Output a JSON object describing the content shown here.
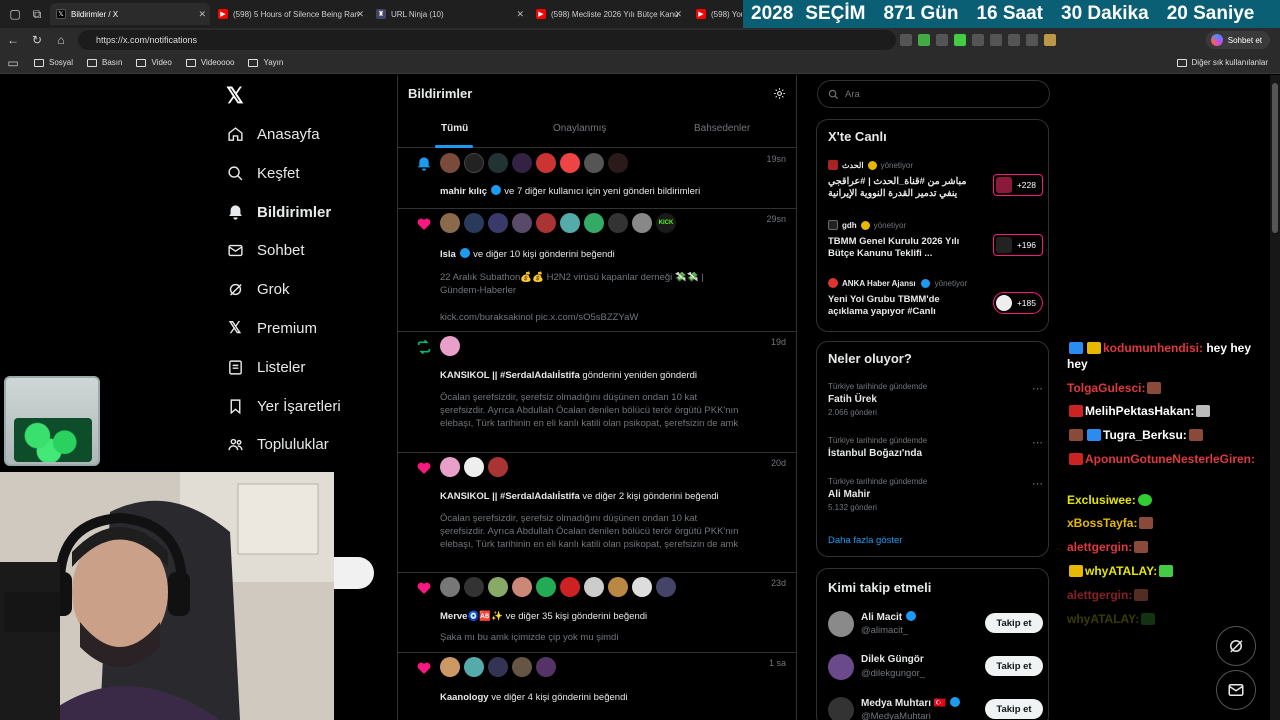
{
  "browser": {
    "tabs": [
      {
        "title": "Bildirimler / X",
        "favicon": "x-logo-icon"
      },
      {
        "title": "(598) 5 Hours of Silence Being Ran",
        "favicon": "youtube-icon"
      },
      {
        "title": "URL Ninja (10)",
        "favicon": "ninja-icon"
      },
      {
        "title": "(598) Mecliste 2026 Yılı Bütçe Kanu",
        "favicon": "youtube-icon"
      },
      {
        "title": "(598) You",
        "favicon": "youtube-icon"
      }
    ],
    "url": "https://x.com/notifications",
    "sohbet_label": "Sohbet et",
    "bookmarks": [
      "Sosyal",
      "Basın",
      "Video",
      "Videoooo",
      "Yayın"
    ],
    "bookmarks_other": "Diğer sık kullanılanlar"
  },
  "countdown": {
    "year": "2028",
    "label": "SEÇİM",
    "days": "871 Gün",
    "hours": "16 Saat",
    "minutes": "30 Dakika",
    "seconds": "20 Saniye"
  },
  "sidebar": {
    "items": [
      {
        "label": "Anasayfa",
        "icon": "home-icon"
      },
      {
        "label": "Keşfet",
        "icon": "search-icon"
      },
      {
        "label": "Bildirimler",
        "icon": "bell-icon"
      },
      {
        "label": "Sohbet",
        "icon": "mail-icon"
      },
      {
        "label": "Grok",
        "icon": "grok-icon"
      },
      {
        "label": "Premium",
        "icon": "x-premium-icon"
      },
      {
        "label": "Listeler",
        "icon": "list-icon"
      },
      {
        "label": "Yer İşaretleri",
        "icon": "bookmark-icon"
      },
      {
        "label": "Topluluklar",
        "icon": "communities-icon"
      }
    ]
  },
  "main": {
    "title": "Bildirimler",
    "tabs": [
      "Tümü",
      "Onaylanmış",
      "Bahsedenler"
    ],
    "notifications": [
      {
        "icon": "bell-icon",
        "time": "19sn",
        "name": "mahir kılıç",
        "text": "ve 7 diğer kullanıcı için yeni gönderi bildirimleri",
        "body": ""
      },
      {
        "icon": "heart-icon",
        "time": "29sn",
        "name": "Isla",
        "text": "ve diğer 10 kişi gönderini beğendi",
        "body": "22 Aralık Subathon💰💰 H2N2 virüsü kapanlar derneği 💸💸 | Gündem-Haberler",
        "link": "kick.com/buraksakinol pic.x.com/sO5sBZZYaW"
      },
      {
        "icon": "retweet-icon",
        "time": "19d",
        "name": "KANSIKOL || #SerdalAdalıİstifa",
        "text": "gönderini yeniden gönderdi",
        "body": "Öcalan şerefsizdir, şerefsiz olmadığını düşünen ondan 10 kat şerefsizdir. Ayrıca Abdullah Öcalan denilen bölücü terör örgütü PKK'nın elebaşı, Türk tarihinin en eli kanlı katili olan psikopat, şerefsizin de amk"
      },
      {
        "icon": "heart-icon",
        "time": "20d",
        "name": "KANSIKOL || #SerdalAdalıİstifa",
        "text": "ve diğer 2 kişi gönderini beğendi",
        "body": "Öcalan şerefsizdir, şerefsiz olmadığını düşünen ondan 10 kat şerefsizdir. Ayrıca Abdullah Öcalan denilen bölücü terör örgütü PKK'nın elebaşı, Türk tarihinin en eli kanlı katili olan psikopat, şerefsizin de amk"
      },
      {
        "icon": "heart-icon",
        "time": "23d",
        "name": "Merve🧿🆎✨",
        "text": "ve diğer 35 kişi gönderini beğendi",
        "body": "Şaka mı bu amk içimizde çip yok mu şimdi"
      },
      {
        "icon": "heart-icon",
        "time": "1 sa",
        "name": "Kaanology",
        "text": "ve diğer 4 kişi gönderini beğendi",
        "body": ""
      }
    ]
  },
  "right": {
    "search_placeholder": "Ara",
    "live": {
      "title": "X'te Canlı",
      "items": [
        {
          "source": "الحدث",
          "role": "yönetiyor",
          "title": "مباشر من #قناة_الحدث | #عراقجي ينفي تدمير القدرة النووية الإيرانية",
          "count": "+228"
        },
        {
          "source": "gdh",
          "role": "yönetiyor",
          "title": "TBMM Genel Kurulu 2026 Yılı Bütçe Kanunu Teklifi ...",
          "count": "+196"
        },
        {
          "source": "ANKA Haber Ajansı",
          "role": "yönetiyor",
          "title": "Yeni Yol Grubu TBMM'de açıklama yapıyor #Canlı",
          "count": "+185"
        }
      ]
    },
    "trends": {
      "title": "Neler oluyor?",
      "items": [
        {
          "context": "Türkiye tarihinde gündemde",
          "name": "Fatih Ürek",
          "count": "2.066 gönderi"
        },
        {
          "context": "Türkiye tarihinde gündemde",
          "name": "İstanbul Boğazı'nda",
          "count": ""
        },
        {
          "context": "Türkiye tarihinde gündemde",
          "name": "Ali Mahir",
          "count": "5.132 gönderi"
        }
      ],
      "more": "Daha fazla göster"
    },
    "follow": {
      "title": "Kimi takip etmeli",
      "button": "Takip et",
      "items": [
        {
          "name": "Ali Macit",
          "handle": "@alimacit_"
        },
        {
          "name": "Dilek Güngör",
          "handle": "@dilekgungor_"
        },
        {
          "name": "Medya Muhtarı 🇹🇷",
          "handle": "@MedyaMuhtari"
        }
      ]
    }
  },
  "chat": [
    {
      "user": "kodumunhendisi:",
      "msg": "hey hey hey"
    },
    {
      "user": "TolgaGulesci:",
      "msg": ""
    },
    {
      "user": "MelihPektasHakan:",
      "msg": ""
    },
    {
      "user": "Tugra_Berksu:",
      "msg": ""
    },
    {
      "user": "AponunGotuneNesterleGiren:",
      "msg": ""
    },
    {
      "user": "Exclusiwee:",
      "msg": ""
    },
    {
      "user": "xBossTayfa:",
      "msg": ""
    },
    {
      "user": "alettgergin:",
      "msg": ""
    },
    {
      "user": "whyATALAY:",
      "msg": ""
    },
    {
      "user": "alettgergin:",
      "msg": ""
    },
    {
      "user": "whyATALAY:",
      "msg": ""
    }
  ],
  "colors": {
    "accent": "#1d9bf0",
    "like": "#f91880",
    "retweet": "#00ba7c",
    "countdown_bg": "#0b5f74"
  }
}
